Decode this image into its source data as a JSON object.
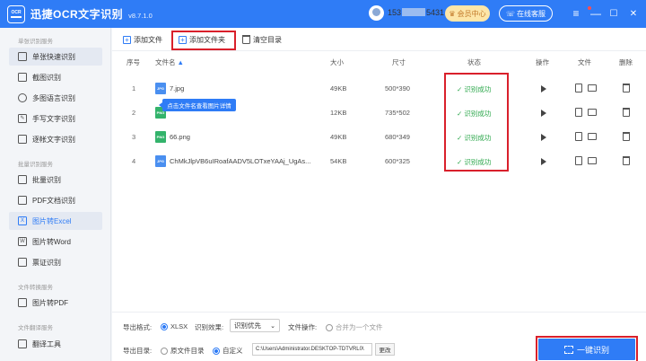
{
  "app": {
    "name": "迅捷OCR文字识别",
    "version": "v8.7.1.0",
    "logo_text": "OCR"
  },
  "header": {
    "user_id_prefix": "153",
    "user_id_suffix": "5431",
    "vip_label": "会员中心",
    "service_label": "在线客服",
    "menu_icon": "≡",
    "minimize_icon": "—",
    "maximize_icon": "☐",
    "close_icon": "✕"
  },
  "sidebar": {
    "groups": [
      {
        "title": "单张识别服务"
      },
      {
        "title": "批量识别服务"
      },
      {
        "title": "文件转换服务"
      },
      {
        "title": "文件翻译服务"
      }
    ],
    "items": [
      {
        "label": "单张快速识别"
      },
      {
        "label": "截图识别"
      },
      {
        "label": "多图语言识别"
      },
      {
        "label": "手写文字识别"
      },
      {
        "label": "逐帐文字识别"
      },
      {
        "label": "批量识别"
      },
      {
        "label": "PDF文档识别"
      },
      {
        "label": "图片转Excel"
      },
      {
        "label": "图片转Word"
      },
      {
        "label": "票证识别"
      },
      {
        "label": "图片转PDF"
      },
      {
        "label": "翻译工具"
      }
    ]
  },
  "toolbar": {
    "add_file": "添加文件",
    "add_folder": "添加文件夹",
    "clear_list": "清空目录"
  },
  "table": {
    "headers": {
      "index": "序号",
      "name": "文件名",
      "size": "大小",
      "dimensions": "尺寸",
      "status": "状态",
      "operation": "操作",
      "file": "文件",
      "delete": "删除"
    },
    "rows": [
      {
        "index": "1",
        "type": "JPG",
        "name": "7.jpg",
        "size": "49KB",
        "dimensions": "500*390",
        "status": "识别成功"
      },
      {
        "index": "2",
        "type": "PNG",
        "name": "",
        "size": "12KB",
        "dimensions": "735*502",
        "status": "识别成功"
      },
      {
        "index": "3",
        "type": "PNG",
        "name": "66.png",
        "size": "49KB",
        "dimensions": "680*349",
        "status": "识别成功"
      },
      {
        "index": "4",
        "type": "JPG",
        "name": "ChMkJlpVB6uIRoafAADV5LOTxeYAAj_UgAs...",
        "size": "54KB",
        "dimensions": "600*325",
        "status": "识别成功"
      }
    ],
    "tooltip": "点击文件名查看图片详情"
  },
  "options": {
    "format_label": "导出格式:",
    "format_value": "XLSX",
    "effect_label": "识别效果:",
    "effect_value": "识别优先",
    "file_op_label": "文件操作:",
    "file_op_value": "合并为一个文件",
    "dir_label": "导出目录:",
    "dir_original": "原文件目录",
    "dir_custom": "自定义",
    "dir_path": "C:\\Users\\Administrator.DESKTOP-TDTVRL0\\",
    "change_label": "更改",
    "ocr_button": "一键识别"
  },
  "colors": {
    "brand": "#2f7cf6",
    "success": "#2ea84d",
    "highlight": "#d9202b"
  }
}
